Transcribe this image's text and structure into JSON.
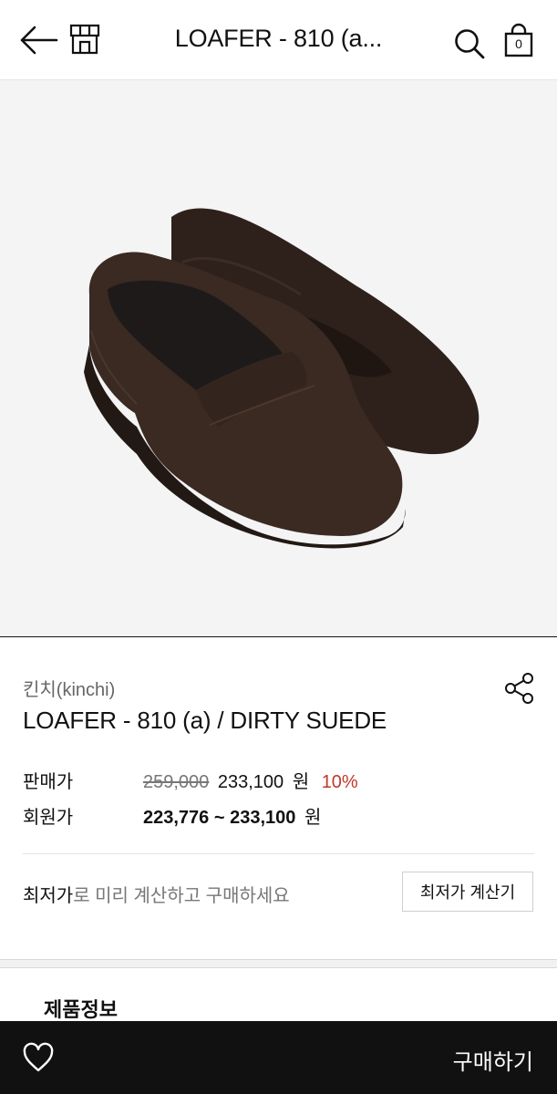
{
  "header": {
    "title": "LOAFER - 810 (a...",
    "cart_count": "0",
    "icons": [
      "back-arrow-icon",
      "store-icon",
      "search-icon",
      "cart-icon"
    ]
  },
  "product": {
    "image": "brown-suede-penny-loafers",
    "brand": "킨치(kinchi)",
    "name": "LOAFER - 810 (a) / DIRTY SUEDE"
  },
  "price": {
    "sale_label": "판매가",
    "original": "259,000",
    "sale": "233,100",
    "unit": "원",
    "discount": "10%",
    "member_label": "회원가",
    "member_range": "223,776 ~ 233,100",
    "member_unit": "원"
  },
  "lowest": {
    "strong": "최저가",
    "rest": "로 미리 계산하고 구매하세요",
    "button_label": "최저가 계산기"
  },
  "section": {
    "title": "제품정보"
  },
  "bottom": {
    "buy_label": "구매하기"
  },
  "colors": {
    "accent_red": "#c0392b",
    "bar": "#111111"
  }
}
